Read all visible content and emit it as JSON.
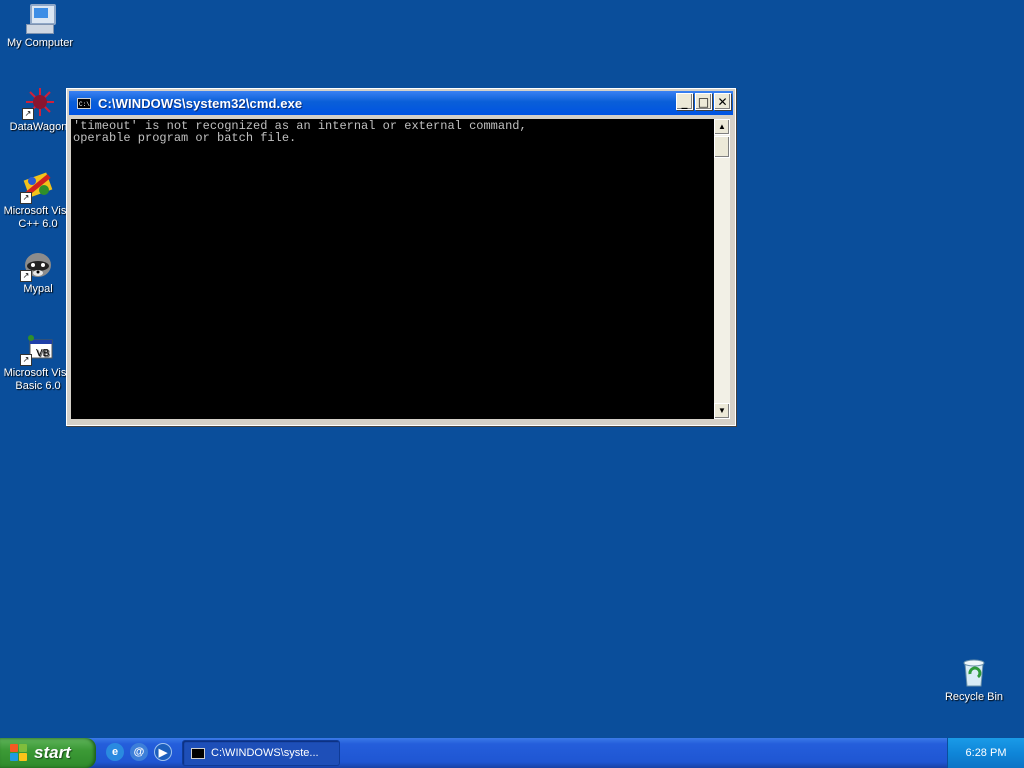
{
  "desktop": {
    "icons": [
      {
        "label": "My Computer",
        "icon": "computer-icon"
      },
      {
        "label": "DataWagon.",
        "icon": "datawagon-icon"
      },
      {
        "label": "Microsoft Visu\nC++ 6.0",
        "icon": "visual-cpp-icon"
      },
      {
        "label": "Mypal",
        "icon": "mypal-raccoon-icon"
      },
      {
        "label": "Microsoft Visu\nBasic 6.0",
        "icon": "visual-basic-icon"
      },
      {
        "label": "Recycle Bin",
        "icon": "recycle-bin-icon"
      }
    ],
    "background_color": "#0a4e9b"
  },
  "window": {
    "title": "C:\\WINDOWS\\system32\\cmd.exe",
    "icon_text": "C:\\",
    "console_lines": [
      "'timeout' is not recognized as an internal or external command,",
      "operable program or batch file."
    ],
    "buttons": {
      "minimize": "_",
      "maximize": "□",
      "close": "✕"
    }
  },
  "taskbar": {
    "start_label": "start",
    "quicklaunch": [
      "internet-explorer-icon",
      "outlook-express-icon",
      "media-player-icon"
    ],
    "task_label": "C:\\WINDOWS\\syste...",
    "clock": "6:28 PM"
  }
}
